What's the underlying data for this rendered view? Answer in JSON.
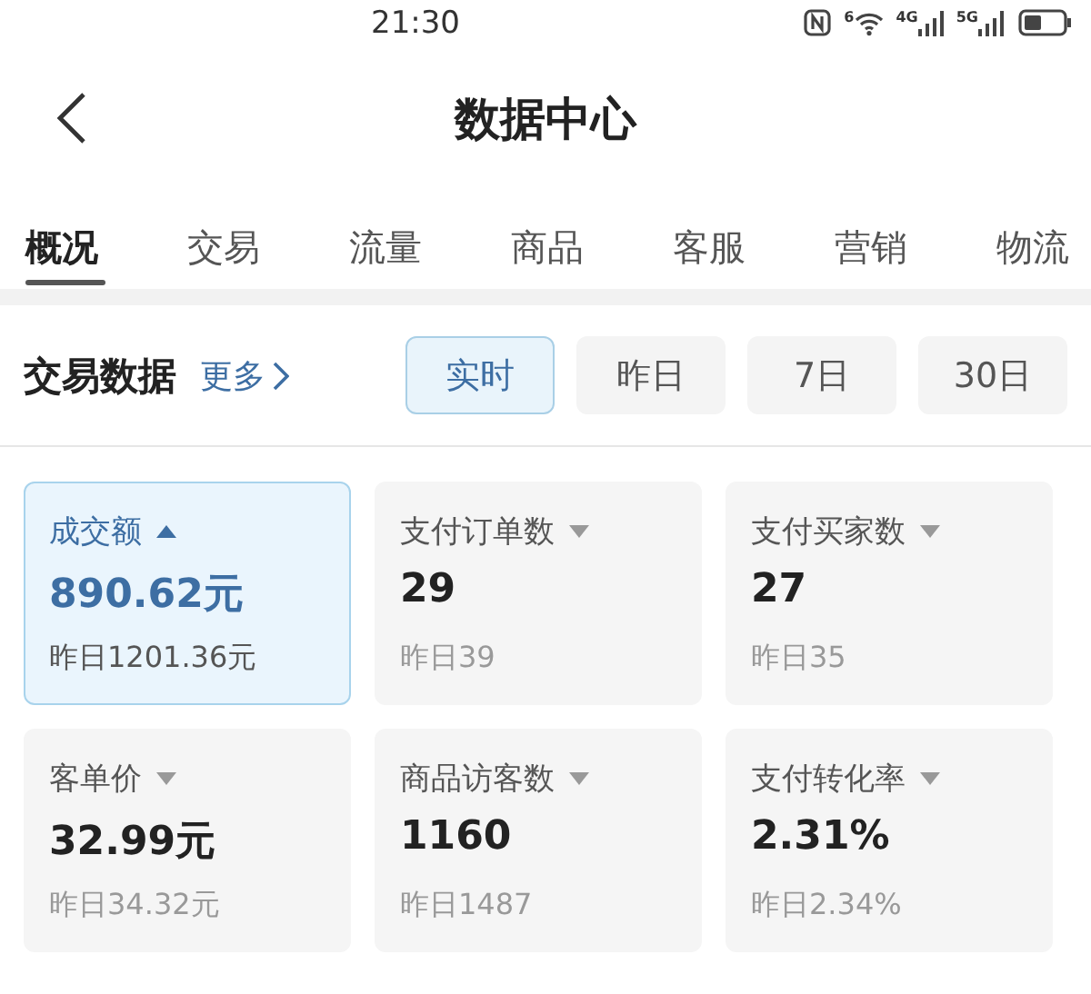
{
  "status_bar": {
    "time": "21:30",
    "wifi_badge": "6",
    "sim1_label": "4G",
    "sim2_label": "5G"
  },
  "header": {
    "title": "数据中心"
  },
  "tabs": [
    {
      "label": "概况",
      "selected": true
    },
    {
      "label": "交易",
      "selected": false
    },
    {
      "label": "流量",
      "selected": false
    },
    {
      "label": "商品",
      "selected": false
    },
    {
      "label": "客服",
      "selected": false
    },
    {
      "label": "营销",
      "selected": false
    },
    {
      "label": "物流",
      "selected": false
    }
  ],
  "section": {
    "title": "交易数据",
    "more_link": "更多",
    "periods": [
      {
        "label": "实时",
        "selected": true
      },
      {
        "label": "昨日",
        "selected": false
      },
      {
        "label": "7日",
        "selected": false
      },
      {
        "label": "30日",
        "selected": false
      }
    ]
  },
  "metrics": [
    {
      "label": "成交额",
      "value": "890.62元",
      "previous": "昨日1201.36元",
      "selected": true
    },
    {
      "label": "支付订单数",
      "value": "29",
      "previous": "昨日39",
      "selected": false
    },
    {
      "label": "支付买家数",
      "value": "27",
      "previous": "昨日35",
      "selected": false
    },
    {
      "label": "客单价",
      "value": "32.99元",
      "previous": "昨日34.32元",
      "selected": false
    },
    {
      "label": "商品访客数",
      "value": "1160",
      "previous": "昨日1487",
      "selected": false
    },
    {
      "label": "支付转化率",
      "value": "2.31%",
      "previous": "昨日2.34%",
      "selected": false
    }
  ]
}
